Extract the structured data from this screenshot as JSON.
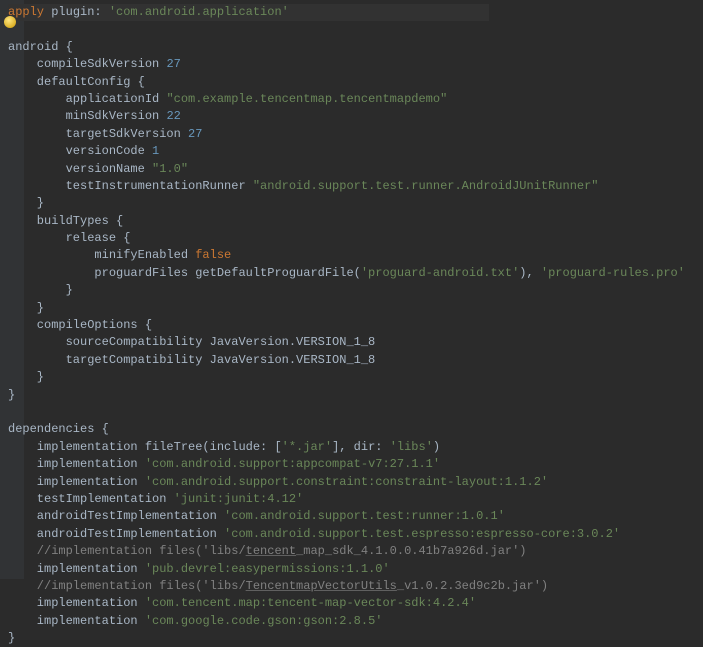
{
  "l1_apply": "apply",
  "l1_rest": " plugin: ",
  "l1_str": "'com.android.application'",
  "l3": "android {",
  "l4a": "    compileSdkVersion ",
  "l4n": "27",
  "l5": "    defaultConfig {",
  "l6a": "        applicationId ",
  "l6s": "\"com.example.tencentmap.tencentmapdemo\"",
  "l7a": "        minSdkVersion ",
  "l7n": "22",
  "l8a": "        targetSdkVersion ",
  "l8n": "27",
  "l9a": "        versionCode ",
  "l9n": "1",
  "l10a": "        versionName ",
  "l10s": "\"1.0\"",
  "l11a": "        testInstrumentationRunner ",
  "l11s": "\"android.support.test.runner.AndroidJUnitRunner\"",
  "l12": "    }",
  "l13": "    buildTypes {",
  "l14": "        release {",
  "l15a": "            minifyEnabled ",
  "l15b": "false",
  "l16a": "            proguardFiles getDefaultProguardFile(",
  "l16s1": "'proguard-android.txt'",
  "l16m": "), ",
  "l16s2": "'proguard-rules.pro'",
  "l17": "        }",
  "l18": "    }",
  "l19": "    compileOptions {",
  "l20": "        sourceCompatibility JavaVersion.VERSION_1_8",
  "l21": "        targetCompatibility JavaVersion.VERSION_1_8",
  "l22": "    }",
  "l23": "}",
  "l25": "dependencies {",
  "l26a": "    implementation fileTree(include: [",
  "l26s1": "'*.jar'",
  "l26m": "], dir: ",
  "l26s2": "'libs'",
  "l26e": ")",
  "l27a": "    implementation ",
  "l27s": "'com.android.support:appcompat-v7:27.1.1'",
  "l28a": "    implementation ",
  "l28s": "'com.android.support.constraint:constraint-layout:1.1.2'",
  "l29a": "    testImplementation ",
  "l29s": "'junit:junit:4.12'",
  "l30a": "    androidTestImplementation ",
  "l30s": "'com.android.support.test:runner:1.0.1'",
  "l31a": "    androidTestImplementation ",
  "l31s": "'com.android.support.test.espresso:espresso-core:3.0.2'",
  "l32a": "    //implementation files('libs/",
  "l32u": "tencent",
  "l32b": "_map_sdk_4.1.0.0.41b7a926d.jar')",
  "l33a": "    implementation ",
  "l33s": "'pub.devrel:easypermissions:1.1.0'",
  "l34a": "    //implementation files('libs/",
  "l34u": "TencentmapVectorUtils",
  "l34b": "_v1.0.2.3ed9c2b.jar')",
  "l35a": "    implementation ",
  "l35s": "'com.tencent.map:tencent-map-vector-sdk:4.2.4'",
  "l36a": "    implementation ",
  "l36s": "'com.google.code.gson:gson:2.8.5'",
  "l37": "}"
}
